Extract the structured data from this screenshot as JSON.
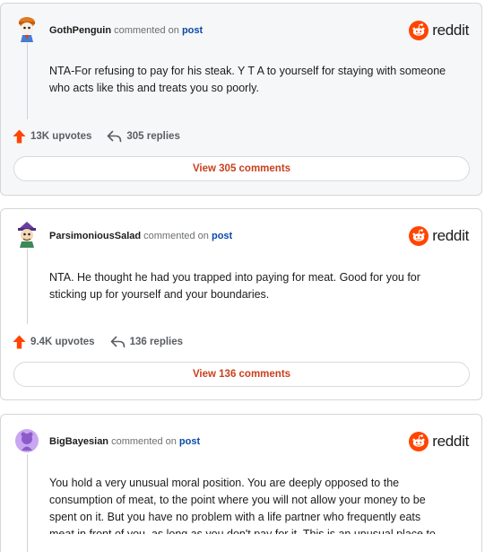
{
  "brand": {
    "wordmark": "reddit",
    "accent": "#ff4500"
  },
  "comments": [
    {
      "username": "GothPenguin",
      "commented_on": "commented on",
      "post_link": "post",
      "body": "NTA-For refusing to pay for his steak. Y T A to yourself for staying with someone who acts like this and treats you so poorly.",
      "upvotes": "13K upvotes",
      "replies": "305 replies",
      "view_button": "View 305 comments"
    },
    {
      "username": "ParsimoniousSalad",
      "commented_on": "commented on",
      "post_link": "post",
      "body": "NTA. He thought he had you trapped into paying for meat. Good for you for sticking up for yourself and your boundaries.",
      "upvotes": "9.4K upvotes",
      "replies": "136 replies",
      "view_button": "View 136 comments"
    },
    {
      "username": "BigBayesian",
      "commented_on": "commented on",
      "post_link": "post",
      "body": "You hold a very unusual moral position. You are deeply opposed to the consumption of meat, to the point where you will not allow your money to be spent on it. But you have no problem with a life partner who frequently eats meat in front of you, as long as you don't pay for it. This is an unusual place to"
    }
  ]
}
